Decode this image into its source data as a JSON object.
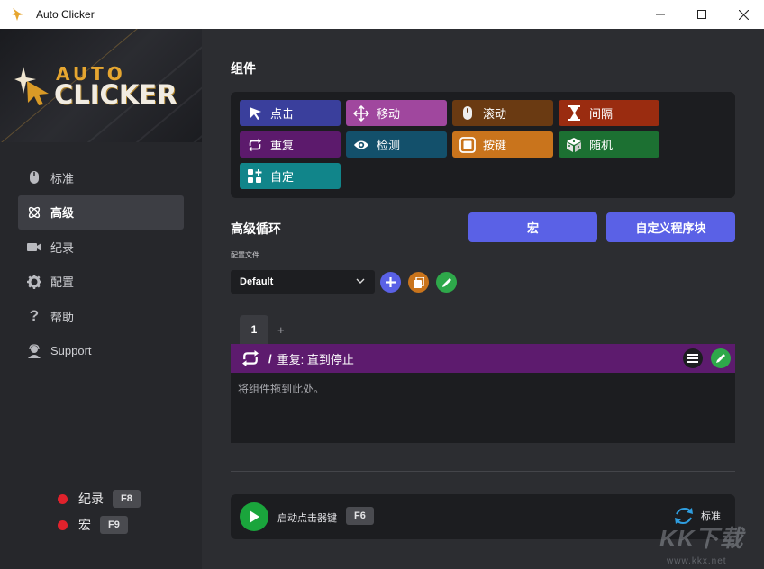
{
  "window": {
    "title": "Auto Clicker",
    "minimize_icon": "minimize-icon",
    "maximize_icon": "maximize-icon",
    "close_icon": "close-icon"
  },
  "logo": {
    "line1": "AUTO",
    "line2": "CLICKER"
  },
  "sidebar": {
    "items": [
      {
        "label": "标准",
        "icon": "mouse-icon"
      },
      {
        "label": "高级",
        "icon": "atom-icon",
        "active": true
      },
      {
        "label": "纪录",
        "icon": "video-camera-icon"
      },
      {
        "label": "配置",
        "icon": "gear-icon"
      },
      {
        "label": "帮助",
        "icon": "question-icon"
      },
      {
        "label": "Support",
        "icon": "support-agent-icon"
      }
    ],
    "hotkeys": [
      {
        "label": "纪录",
        "key": "F8"
      },
      {
        "label": "宏",
        "key": "F9"
      }
    ]
  },
  "components": {
    "heading": "组件",
    "buttons": [
      {
        "label": "点击",
        "icon": "cursor-icon",
        "color": "#3a3f9c"
      },
      {
        "label": "移动",
        "icon": "move-arrows-icon",
        "color": "#a0479e"
      },
      {
        "label": "滚动",
        "icon": "scroll-mouse-icon",
        "color": "#6a3a12"
      },
      {
        "label": "间隔",
        "icon": "hourglass-icon",
        "color": "#9a2c10"
      },
      {
        "label": "重复",
        "icon": "repeat-icon",
        "color": "#5c1a6c"
      },
      {
        "label": "检测",
        "icon": "eye-icon",
        "color": "#13506b"
      },
      {
        "label": "按键",
        "icon": "key-icon",
        "color": "#c9741c"
      },
      {
        "label": "随机",
        "icon": "dice-icon",
        "color": "#1c7032"
      },
      {
        "label": "自定",
        "icon": "blocks-icon",
        "color": "#11858a"
      }
    ]
  },
  "loop": {
    "heading": "高级循环",
    "macro_button": "宏",
    "custom_block_button": "自定义程序块",
    "profile_label": "配置文件",
    "profile_value": "Default",
    "tabs": [
      "1"
    ],
    "tab_add": "+",
    "header_text": "重复: 直到停止",
    "header_sep": "/",
    "drop_hint": "将组件拖到此处。"
  },
  "footer": {
    "start_label": "启动点击器键",
    "start_key": "F6",
    "mode_label": "标准"
  },
  "watermark": {
    "brand": "KK下载",
    "url": "www.kkx.net"
  }
}
